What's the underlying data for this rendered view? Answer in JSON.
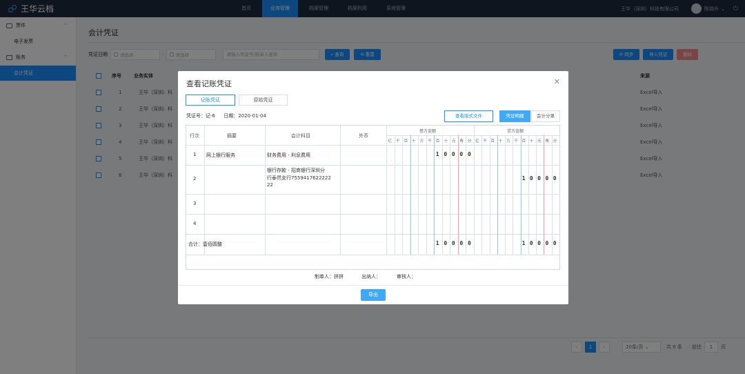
{
  "app": {
    "name": "王华云档"
  },
  "nav": [
    {
      "label": "首页",
      "active": false
    },
    {
      "label": "业务管理",
      "active": true
    },
    {
      "label": "档案管理",
      "active": false
    },
    {
      "label": "档案利用",
      "active": false
    },
    {
      "label": "系统管理",
      "active": false
    }
  ],
  "topbar": {
    "company": "王华（深圳）科技有限公司",
    "user": "陈晓升"
  },
  "sidebar": {
    "groups": [
      {
        "label": "票件",
        "items": [
          {
            "label": "电子发票",
            "active": false
          }
        ]
      },
      {
        "label": "账务",
        "items": [
          {
            "label": "会计凭证",
            "active": true
          }
        ]
      }
    ]
  },
  "page": {
    "title": "会计凭证",
    "filter": {
      "label": "凭证日期",
      "date_placeholder": "请选择",
      "search_placeholder": "请输入凭证号/制单人查询",
      "query": "查询",
      "reset": "重置",
      "sync": "同步",
      "import": "导入凭证",
      "delete": "删除"
    },
    "table": {
      "headers": {
        "idx": "序号",
        "entity": "业务实体",
        "source": "来源"
      },
      "rows": [
        {
          "idx": "1",
          "entity": "王华（深圳）科",
          "source": "Excel导入"
        },
        {
          "idx": "2",
          "entity": "王华（深圳）科",
          "source": "Excel导入"
        },
        {
          "idx": "3",
          "entity": "王华（深圳）科",
          "source": "Excel导入"
        },
        {
          "idx": "4",
          "entity": "王华（深圳）科",
          "source": "Excel导入"
        },
        {
          "idx": "5",
          "entity": "王华（深圳）科",
          "source": "Excel导入"
        },
        {
          "idx": "6",
          "entity": "王华（深圳）科",
          "source": "Excel导入"
        }
      ]
    },
    "pager": {
      "current": "1",
      "page_size": "20条/页",
      "total": "共 6 条",
      "goto_label": "前往",
      "goto_value": "1",
      "page_unit": "页"
    }
  },
  "modal": {
    "title": "查看记账凭证",
    "tabs": [
      {
        "label": "记账凭证",
        "active": true
      },
      {
        "label": "原始凭证",
        "active": false
      }
    ],
    "voucher_no": "凭证号：记-6",
    "date": "日期：2020-01-04",
    "buttons": {
      "view_file": "查看版式文件",
      "detail": "凭证明细",
      "subject": "会计分录"
    },
    "headers": {
      "row": "行次",
      "summary": "摘要",
      "account": "会计科目",
      "foreign": "外币",
      "debit": "借方金额",
      "credit": "贷方金额"
    },
    "units": [
      "亿",
      "千",
      "百",
      "十",
      "万",
      "千",
      "百",
      "十",
      "元",
      "角",
      "分"
    ],
    "lines": [
      {
        "row": "1",
        "summary": "网上银行服务",
        "account": [
          "财务费用 - 利息费用"
        ],
        "debit": [
          "",
          "",
          "",
          "",
          "",
          "",
          "1",
          "0",
          "0",
          "0",
          "0"
        ],
        "credit": [
          "",
          "",
          "",
          "",
          "",
          "",
          "",
          "",
          "",
          "",
          ""
        ]
      },
      {
        "row": "2",
        "summary": "",
        "account": [
          "银行存款 - 招商银行深圳分",
          "行泰然支行7559417622222",
          "22"
        ],
        "debit": [
          "",
          "",
          "",
          "",
          "",
          "",
          "",
          "",
          "",
          "",
          ""
        ],
        "credit": [
          "",
          "",
          "",
          "",
          "",
          "",
          "1",
          "0",
          "0",
          "0",
          "0"
        ]
      },
      {
        "row": "3",
        "summary": "",
        "account": [],
        "debit": [],
        "credit": []
      },
      {
        "row": "4",
        "summary": "",
        "account": [],
        "debit": [],
        "credit": []
      }
    ],
    "total": {
      "label": "合计：壹佰圆整",
      "debit": [
        "",
        "",
        "",
        "",
        "",
        "",
        "1",
        "0",
        "0",
        "0",
        "0"
      ],
      "credit": [
        "",
        "",
        "",
        "",
        "",
        "",
        "1",
        "0",
        "0",
        "0",
        "0"
      ]
    },
    "sign": {
      "maker": "制单人：拼拼",
      "cashier": "出纳人：",
      "auditor": "审核人："
    },
    "export": "导出"
  }
}
